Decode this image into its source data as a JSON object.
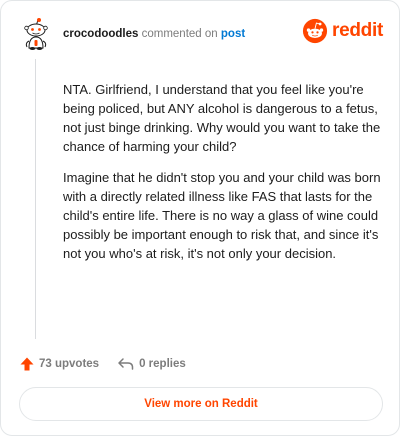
{
  "header": {
    "username": "crocodoodles",
    "action_text": "commented on",
    "post_link": "post",
    "logo_text": "reddit"
  },
  "comment": {
    "paragraphs": [
      "NTA. Girlfriend, I understand that you feel like you're being policed, but ANY alcohol is dangerous to a fetus, not just binge drinking. Why would you want to take the chance of harming your child?",
      "Imagine that he didn't stop you and your child was born with a directly related illness like FAS that lasts for the child's entire life. There is no way a glass of wine could possibly be important enough to risk that, and since it's not you who's at risk, it's not only your decision."
    ]
  },
  "footer": {
    "upvotes_label": "73 upvotes",
    "replies_label": "0 replies",
    "view_more_label": "View more on Reddit"
  },
  "icons": {
    "upvote": "upvote-arrow-icon",
    "reply": "reply-arrow-icon",
    "avatar": "snoo-avatar-icon",
    "logo": "reddit-logo-icon"
  },
  "colors": {
    "brand": "#ff4500",
    "link": "#0079d3",
    "muted": "#7c7c7c",
    "text": "#1c1c1c"
  }
}
